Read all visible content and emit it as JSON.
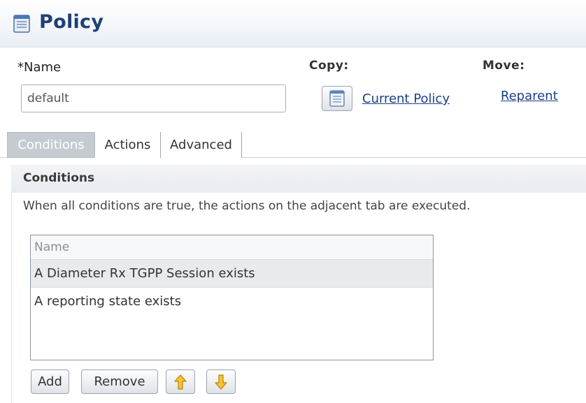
{
  "header": {
    "title": "Policy",
    "icon": "policy-document-icon"
  },
  "form": {
    "name_label": "*Name",
    "name_value": "default",
    "copy_label": "Copy:",
    "copy_link": "Current Policy",
    "copy_icon": "policy-document-icon",
    "move_label": "Move:",
    "move_link": "Reparent"
  },
  "tabs": [
    {
      "label": "Conditions",
      "active": true
    },
    {
      "label": "Actions",
      "active": false
    },
    {
      "label": "Advanced",
      "active": false
    }
  ],
  "conditions": {
    "title": "Conditions",
    "description": "When all conditions are true, the actions on the adjacent tab are executed.",
    "grid": {
      "column_header": "Name",
      "rows": [
        "A Diameter Rx TGPP Session exists",
        "A reporting state exists"
      ]
    },
    "buttons": {
      "add": "Add",
      "remove": "Remove",
      "up_icon": "arrow-up-icon",
      "down_icon": "arrow-down-icon"
    }
  },
  "colors": {
    "title": "#1f3f77",
    "link": "#1b3f86",
    "arrow": "#f2b31a"
  }
}
